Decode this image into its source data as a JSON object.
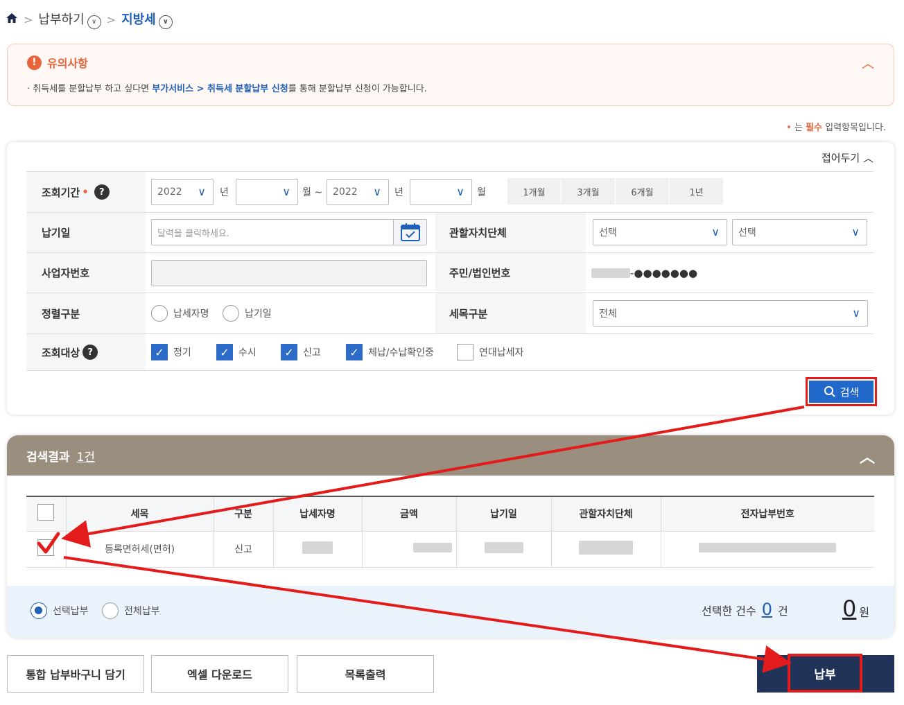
{
  "breadcrumb": {
    "level1": "납부하기",
    "level2": "지방세"
  },
  "notice": {
    "title": "유의사항",
    "text_before": "· 취득세를 분할납부 하고 싶다면 ",
    "text_link": "부가서비스 > 취득세 분할납부 신청",
    "text_after": "를 통해 분할납부 신청이 가능합니다."
  },
  "required_note": {
    "dot": "•",
    "prefix": "는 ",
    "bold": "필수",
    "suffix": " 입력항목입니다."
  },
  "search": {
    "collapse_label": "접어두기",
    "period": {
      "label": "조회기간",
      "required_mark": "•",
      "start_year": "2022",
      "start_month": "",
      "end_year": "2022",
      "end_month": "",
      "unit_year": "년",
      "unit_month": "월",
      "unit_month_tilde": "월 ~",
      "quick_buttons": [
        "1개월",
        "3개월",
        "6개월",
        "1년"
      ]
    },
    "due_date": {
      "label": "납기일",
      "placeholder": "달력을 클릭하세요."
    },
    "authority": {
      "label": "관할자치단체",
      "select1": "선택",
      "select2": "선택"
    },
    "business_no": {
      "label": "사업자번호"
    },
    "resident_no": {
      "label": "주민/법인번호",
      "masked": "-●●●●●●●"
    },
    "sort": {
      "label": "정렬구분",
      "options": [
        "납세자명",
        "납기일"
      ]
    },
    "tax_type": {
      "label": "세목구분",
      "value": "전체"
    },
    "target": {
      "label": "조회대상",
      "options": [
        {
          "label": "정기",
          "checked": true
        },
        {
          "label": "수시",
          "checked": true
        },
        {
          "label": "신고",
          "checked": true
        },
        {
          "label": "체납/수납확인중",
          "checked": true
        },
        {
          "label": "연대납세자",
          "checked": false
        }
      ]
    },
    "search_button": "검색"
  },
  "results": {
    "title": "검색결과",
    "count": "1건",
    "columns": [
      "세목",
      "구분",
      "납세자명",
      "금액",
      "납기일",
      "관할자치단체",
      "전자납부번호"
    ],
    "rows": [
      {
        "tax_item": "등록면허세(면허)",
        "type": "신고"
      }
    ],
    "pay_mode": {
      "selected": "선택납부",
      "all": "전체납부"
    },
    "selected_count_label": "선택한 건수",
    "selected_count": "0",
    "count_unit": "건",
    "amount": "0",
    "amount_unit": "원"
  },
  "buttons": {
    "cart": "통합 납부바구니 담기",
    "excel": "엑셀 다운로드",
    "print": "목록출력",
    "pay": "납부"
  },
  "colors": {
    "accent": "#1f5fb5",
    "warning": "#e8643a",
    "annotation": "#e31b1b",
    "results_header": "#9a8f7e",
    "pay_button": "#22335a"
  }
}
